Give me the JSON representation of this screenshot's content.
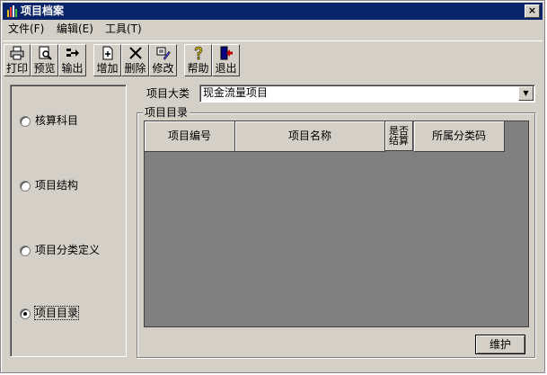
{
  "window": {
    "title": "项目档案",
    "close_label": "×"
  },
  "menu": [
    {
      "label": "文件(F)"
    },
    {
      "label": "编辑(E)"
    },
    {
      "label": "工具(T)"
    }
  ],
  "toolbar": [
    {
      "label": "打印",
      "icon": "printer-icon"
    },
    {
      "label": "预览",
      "icon": "preview-icon"
    },
    {
      "label": "输出",
      "icon": "export-icon"
    },
    {
      "label": "增加",
      "icon": "add-icon"
    },
    {
      "label": "删除",
      "icon": "delete-icon"
    },
    {
      "label": "修改",
      "icon": "edit-icon"
    },
    {
      "label": "帮助",
      "icon": "help-icon"
    },
    {
      "label": "退出",
      "icon": "exit-icon"
    }
  ],
  "options": [
    {
      "label": "核算科目",
      "selected": false
    },
    {
      "label": "项目结构",
      "selected": false
    },
    {
      "label": "项目分类定义",
      "selected": false
    },
    {
      "label": "项目目录",
      "selected": true
    }
  ],
  "category": {
    "label": "项目大类",
    "value": "现金流量项目"
  },
  "catalog": {
    "title": "项目目录",
    "columns": [
      {
        "label": "项目编号"
      },
      {
        "label": "项目名称"
      },
      {
        "label": "是否结算"
      },
      {
        "label": "所属分类码"
      }
    ],
    "rows": []
  },
  "maintain_button": "维护"
}
